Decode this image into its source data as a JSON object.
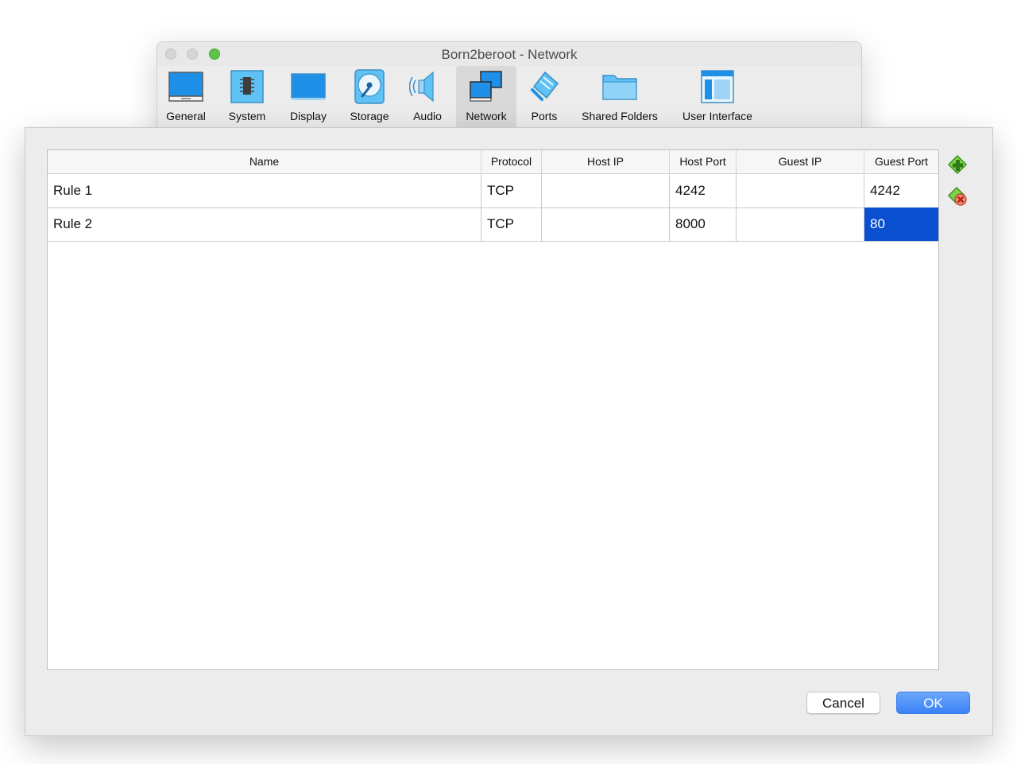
{
  "window": {
    "title": "Born2beroot - Network",
    "traffic_lights": [
      "close",
      "minimize",
      "zoom"
    ]
  },
  "toolbar": {
    "items": [
      {
        "label": "General",
        "icon": "general-icon",
        "selected": false
      },
      {
        "label": "System",
        "icon": "system-icon",
        "selected": false
      },
      {
        "label": "Display",
        "icon": "display-icon",
        "selected": false
      },
      {
        "label": "Storage",
        "icon": "storage-icon",
        "selected": false
      },
      {
        "label": "Audio",
        "icon": "audio-icon",
        "selected": false
      },
      {
        "label": "Network",
        "icon": "network-icon",
        "selected": true
      },
      {
        "label": "Ports",
        "icon": "ports-icon",
        "selected": false
      },
      {
        "label": "Shared Folders",
        "icon": "shared-folders-icon",
        "selected": false
      },
      {
        "label": "User Interface",
        "icon": "user-interface-icon",
        "selected": false
      }
    ]
  },
  "table": {
    "columns": [
      "Name",
      "Protocol",
      "Host IP",
      "Host Port",
      "Guest IP",
      "Guest Port"
    ],
    "rows": [
      {
        "name": "Rule 1",
        "protocol": "TCP",
        "host_ip": "",
        "host_port": "4242",
        "guest_ip": "",
        "guest_port": "4242"
      },
      {
        "name": "Rule 2",
        "protocol": "TCP",
        "host_ip": "",
        "host_port": "8000",
        "guest_ip": "",
        "guest_port": "80"
      }
    ],
    "selected": {
      "row": 2,
      "column": "Guest Port"
    }
  },
  "side_actions": {
    "add": "add-rule-icon",
    "remove": "remove-rule-icon"
  },
  "buttons": {
    "cancel": "Cancel",
    "ok": "OK"
  },
  "colors": {
    "selection": "#0a4fd0",
    "ok_button": "#3b82f6",
    "zoom_light": "#5cc44b",
    "icon_blue": "#1e90e8"
  }
}
